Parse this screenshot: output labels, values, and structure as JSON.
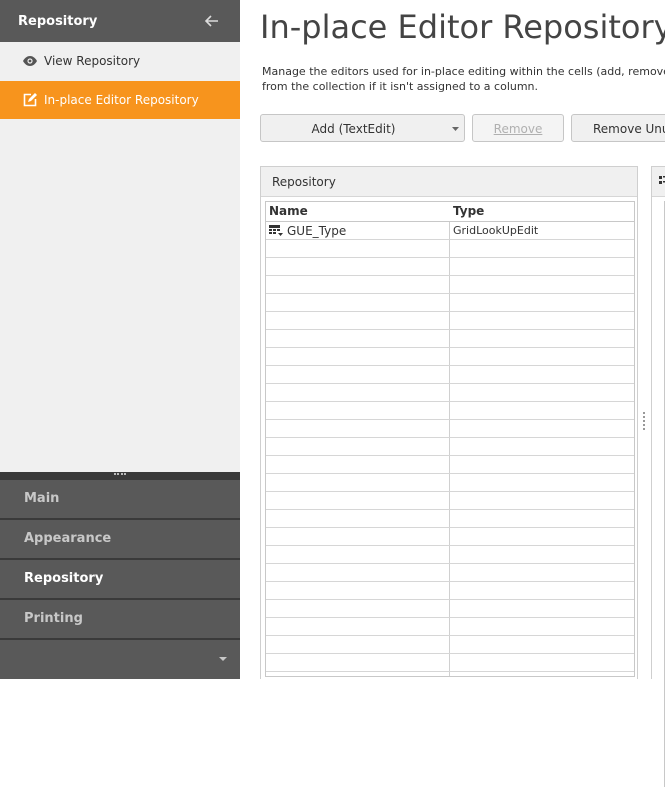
{
  "sidebar": {
    "header_title": "Repository",
    "items": [
      {
        "label": "View Repository",
        "icon": "eye-icon",
        "active": false
      },
      {
        "label": "In-place Editor Repository",
        "icon": "edit-icon",
        "active": true
      }
    ]
  },
  "bottom_nav": {
    "items": [
      {
        "label": "Main"
      },
      {
        "label": "Appearance"
      },
      {
        "label": "Repository",
        "current": true
      },
      {
        "label": "Printing"
      }
    ]
  },
  "main": {
    "title": "In-place Editor Repository",
    "description_line1": "Manage the editors used for in-place editing within the cells (add, remove,",
    "description_line2": "from the collection if it isn't assigned to a column.",
    "buttons": {
      "add": "Add (TextEdit)",
      "remove": "Remove",
      "remove_unused": "Remove Unus"
    },
    "panel_title": "Repository",
    "grid": {
      "columns": [
        "Name",
        "Type"
      ],
      "rows": [
        {
          "name": "GUE_Type",
          "type": "GridLookUpEdit",
          "icon": "grid-lookup-icon"
        }
      ]
    }
  },
  "colors": {
    "accent": "#f7941d",
    "sidebar_header": "#595959",
    "sidebar_bg": "#f0f0f0"
  }
}
